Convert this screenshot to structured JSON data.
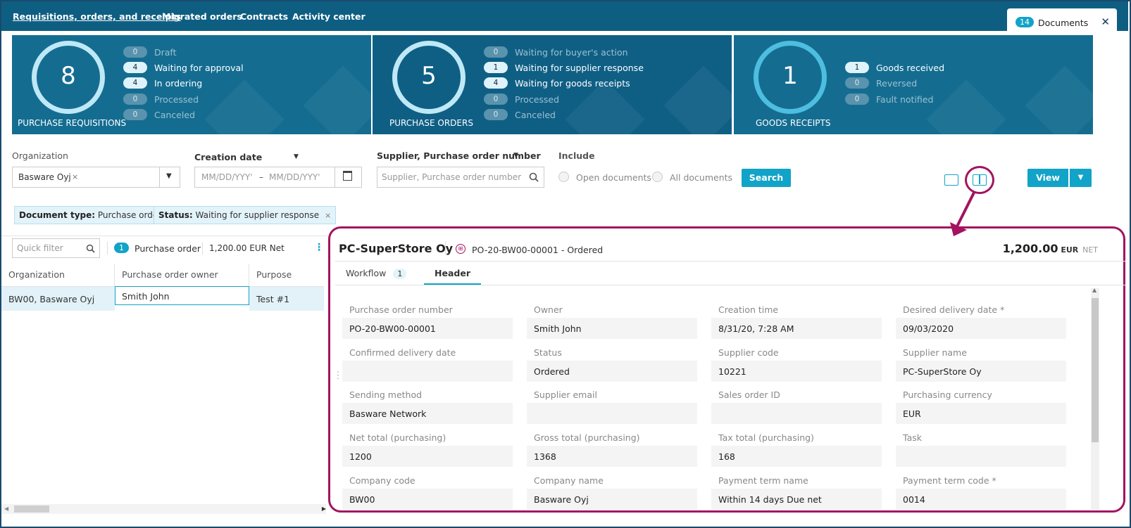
{
  "nav": {
    "links": [
      "Requisitions, orders, and receipts",
      "Migrated orders",
      "Contracts",
      "Activity center"
    ],
    "docs_count": "14",
    "docs_label": "Documents"
  },
  "summary": [
    {
      "count": "8",
      "caption": "PURCHASE REQUISITIONS",
      "rows": [
        {
          "value": "0",
          "label": "Draft",
          "active": false
        },
        {
          "value": "4",
          "label": "Waiting for approval",
          "active": true
        },
        {
          "value": "4",
          "label": "In ordering",
          "active": true
        },
        {
          "value": "0",
          "label": "Processed",
          "active": false
        },
        {
          "value": "0",
          "label": "Canceled",
          "active": false
        }
      ]
    },
    {
      "count": "5",
      "caption": "PURCHASE ORDERS",
      "rows": [
        {
          "value": "0",
          "label": "Waiting for buyer's action",
          "active": false
        },
        {
          "value": "1",
          "label": "Waiting for supplier response",
          "active": true
        },
        {
          "value": "4",
          "label": "Waiting for goods receipts",
          "active": true
        },
        {
          "value": "0",
          "label": "Processed",
          "active": false
        },
        {
          "value": "0",
          "label": "Canceled",
          "active": false
        }
      ]
    },
    {
      "count": "1",
      "caption": "GOODS RECEIPTS",
      "rows": [
        {
          "value": "1",
          "label": "Goods received",
          "active": true
        },
        {
          "value": "0",
          "label": "Reversed",
          "active": false
        },
        {
          "value": "0",
          "label": "Fault notified",
          "active": false
        }
      ]
    }
  ],
  "filters": {
    "org_label": "Organization",
    "org_value": "Basware Oyj",
    "date_label": "Creation date",
    "date_from": "MM/DD/YYY'",
    "date_sep": "–",
    "date_to": "MM/DD/YYY'",
    "supplier_label": "Supplier, Purchase order number",
    "supplier_placeholder": "Supplier, Purchase order number",
    "include_label": "Include",
    "open_docs": "Open documents",
    "all_docs": "All documents",
    "search": "Search",
    "view": "View"
  },
  "chips": [
    {
      "key": "Document type:",
      "value": "Purchase order"
    },
    {
      "key": "Status:",
      "value": "Waiting for supplier response"
    }
  ],
  "list": {
    "quick_filter": "Quick filter",
    "count": "1",
    "type": "Purchase order",
    "total": "1,200.00 EUR Net",
    "columns": [
      "Organization",
      "Purchase order owner",
      "Purpose"
    ],
    "row": [
      "BW00, Basware Oyj",
      "Smith John",
      "Test #1"
    ]
  },
  "detail": {
    "supplier": "PC-SuperStore Oy",
    "po_status": "PO-20-BW00-00001 - Ordered",
    "amount": "1,200.00",
    "currency": "EUR",
    "net": "NET",
    "tab_workflow": "Workflow",
    "tab_workflow_count": "1",
    "tab_header": "Header",
    "fields": [
      {
        "label": "Purchase order number",
        "value": "PO-20-BW00-00001"
      },
      {
        "label": "Owner",
        "value": "Smith John"
      },
      {
        "label": "Creation time",
        "value": "8/31/20, 7:28 AM"
      },
      {
        "label": "Desired delivery date *",
        "value": "09/03/2020"
      },
      {
        "label": "Confirmed delivery date",
        "value": ""
      },
      {
        "label": "Status",
        "value": "Ordered"
      },
      {
        "label": "Supplier code",
        "value": "10221"
      },
      {
        "label": "Supplier name",
        "value": "PC-SuperStore Oy"
      },
      {
        "label": "Sending method",
        "value": "Basware Network"
      },
      {
        "label": "Supplier email",
        "value": ""
      },
      {
        "label": "Sales order ID",
        "value": ""
      },
      {
        "label": "Purchasing currency",
        "value": "EUR"
      },
      {
        "label": "Net total (purchasing)",
        "value": "1200"
      },
      {
        "label": "Gross total (purchasing)",
        "value": "1368"
      },
      {
        "label": "Tax total (purchasing)",
        "value": "168"
      },
      {
        "label": "Task",
        "value": ""
      },
      {
        "label": "Company code",
        "value": "BW00"
      },
      {
        "label": "Company name",
        "value": "Basware Oyj"
      },
      {
        "label": "Payment term name",
        "value": "Within 14 days Due net"
      },
      {
        "label": "Payment term code *",
        "value": "0014"
      }
    ]
  },
  "colors": {
    "nav": "#0e5e82",
    "accent": "#12a3c8",
    "highlight": "#a3135f"
  }
}
